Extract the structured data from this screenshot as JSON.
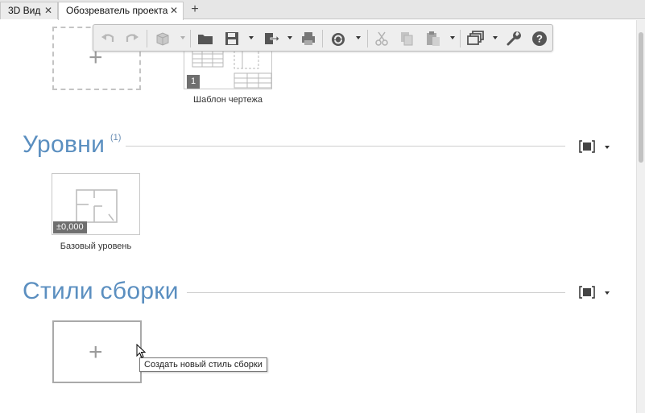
{
  "tabs": [
    {
      "label": "3D Вид",
      "close": "✕"
    },
    {
      "label": "Обозреватель проекта",
      "close": "✕"
    }
  ],
  "tab_add": "+",
  "toolbar": {
    "buttons": [
      "undo-icon",
      "redo-icon",
      "3d-box-icon",
      "open-folder-icon",
      "save-icon",
      "export-icon",
      "print-icon",
      "sync-icon",
      "cut-icon",
      "copy-icon",
      "paste-icon",
      "layers-icon",
      "wrench-icon",
      "help-icon"
    ],
    "help_glyph": "?"
  },
  "drawing_template": {
    "caption": "Шаблон чертежа",
    "badge": "1"
  },
  "levels": {
    "title": "Уровни",
    "count": "(1)",
    "item": {
      "caption": "Базовый уровень",
      "badge": "±0,000"
    }
  },
  "assembly_styles": {
    "title": "Стили сборки",
    "add_plus": "+",
    "tooltip": "Создать новый стиль сборки"
  },
  "dashed_plus": "+",
  "colors": {
    "section_title": "#5b8fc0",
    "tab_bar": "#e6e6e6",
    "toolbar_bg": "#eeeeee"
  }
}
